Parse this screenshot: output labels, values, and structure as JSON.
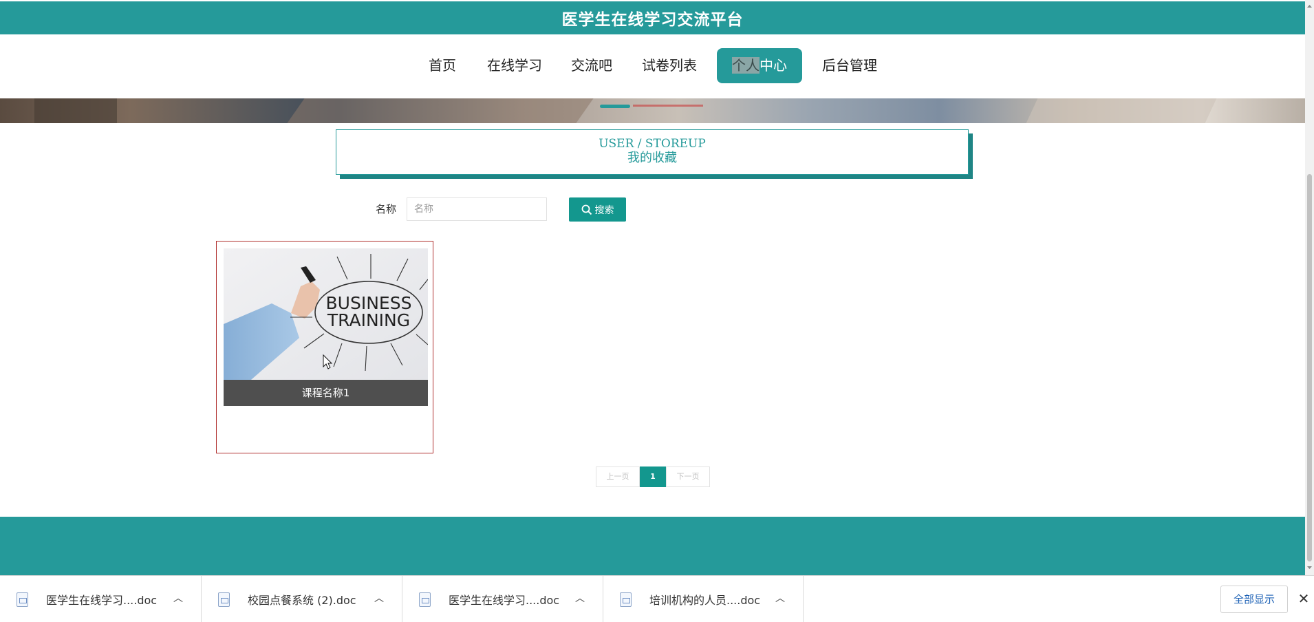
{
  "site": {
    "title": "医学生在线学习交流平台"
  },
  "nav": {
    "items": [
      {
        "label": "首页"
      },
      {
        "label": "在线学习"
      },
      {
        "label": "交流吧"
      },
      {
        "label": "试卷列表"
      },
      {
        "label_selected": "个人",
        "label_rest": "中心",
        "active": true
      },
      {
        "label": "后台管理"
      }
    ]
  },
  "section": {
    "en": "USER / STOREUP",
    "cn": "我的收藏"
  },
  "search": {
    "label": "名称",
    "placeholder": "名称",
    "value": "",
    "button_label": "搜索"
  },
  "favorites": [
    {
      "title": "课程名称1",
      "image_text": [
        "BUSINESS",
        "TRAINING"
      ]
    }
  ],
  "pagination": {
    "prev": "上一页",
    "current": "1",
    "next": "下一页"
  },
  "downloads": [
    {
      "name": "医学生在线学习....doc"
    },
    {
      "name": "校园点餐系统 (2).doc"
    },
    {
      "name": "医学生在线学习....doc"
    },
    {
      "name": "培训机构的人员....doc"
    }
  ],
  "download_bar": {
    "show_all": "全部显示",
    "close": "✕"
  },
  "colors": {
    "brand": "#259a9a",
    "button": "#13978e",
    "card_border": "#b0302e",
    "card_title_bg": "#4f4f4f"
  },
  "icons": [
    "search-icon",
    "document-icon",
    "chevron-up-icon",
    "close-icon",
    "mouse-cursor-icon"
  ]
}
